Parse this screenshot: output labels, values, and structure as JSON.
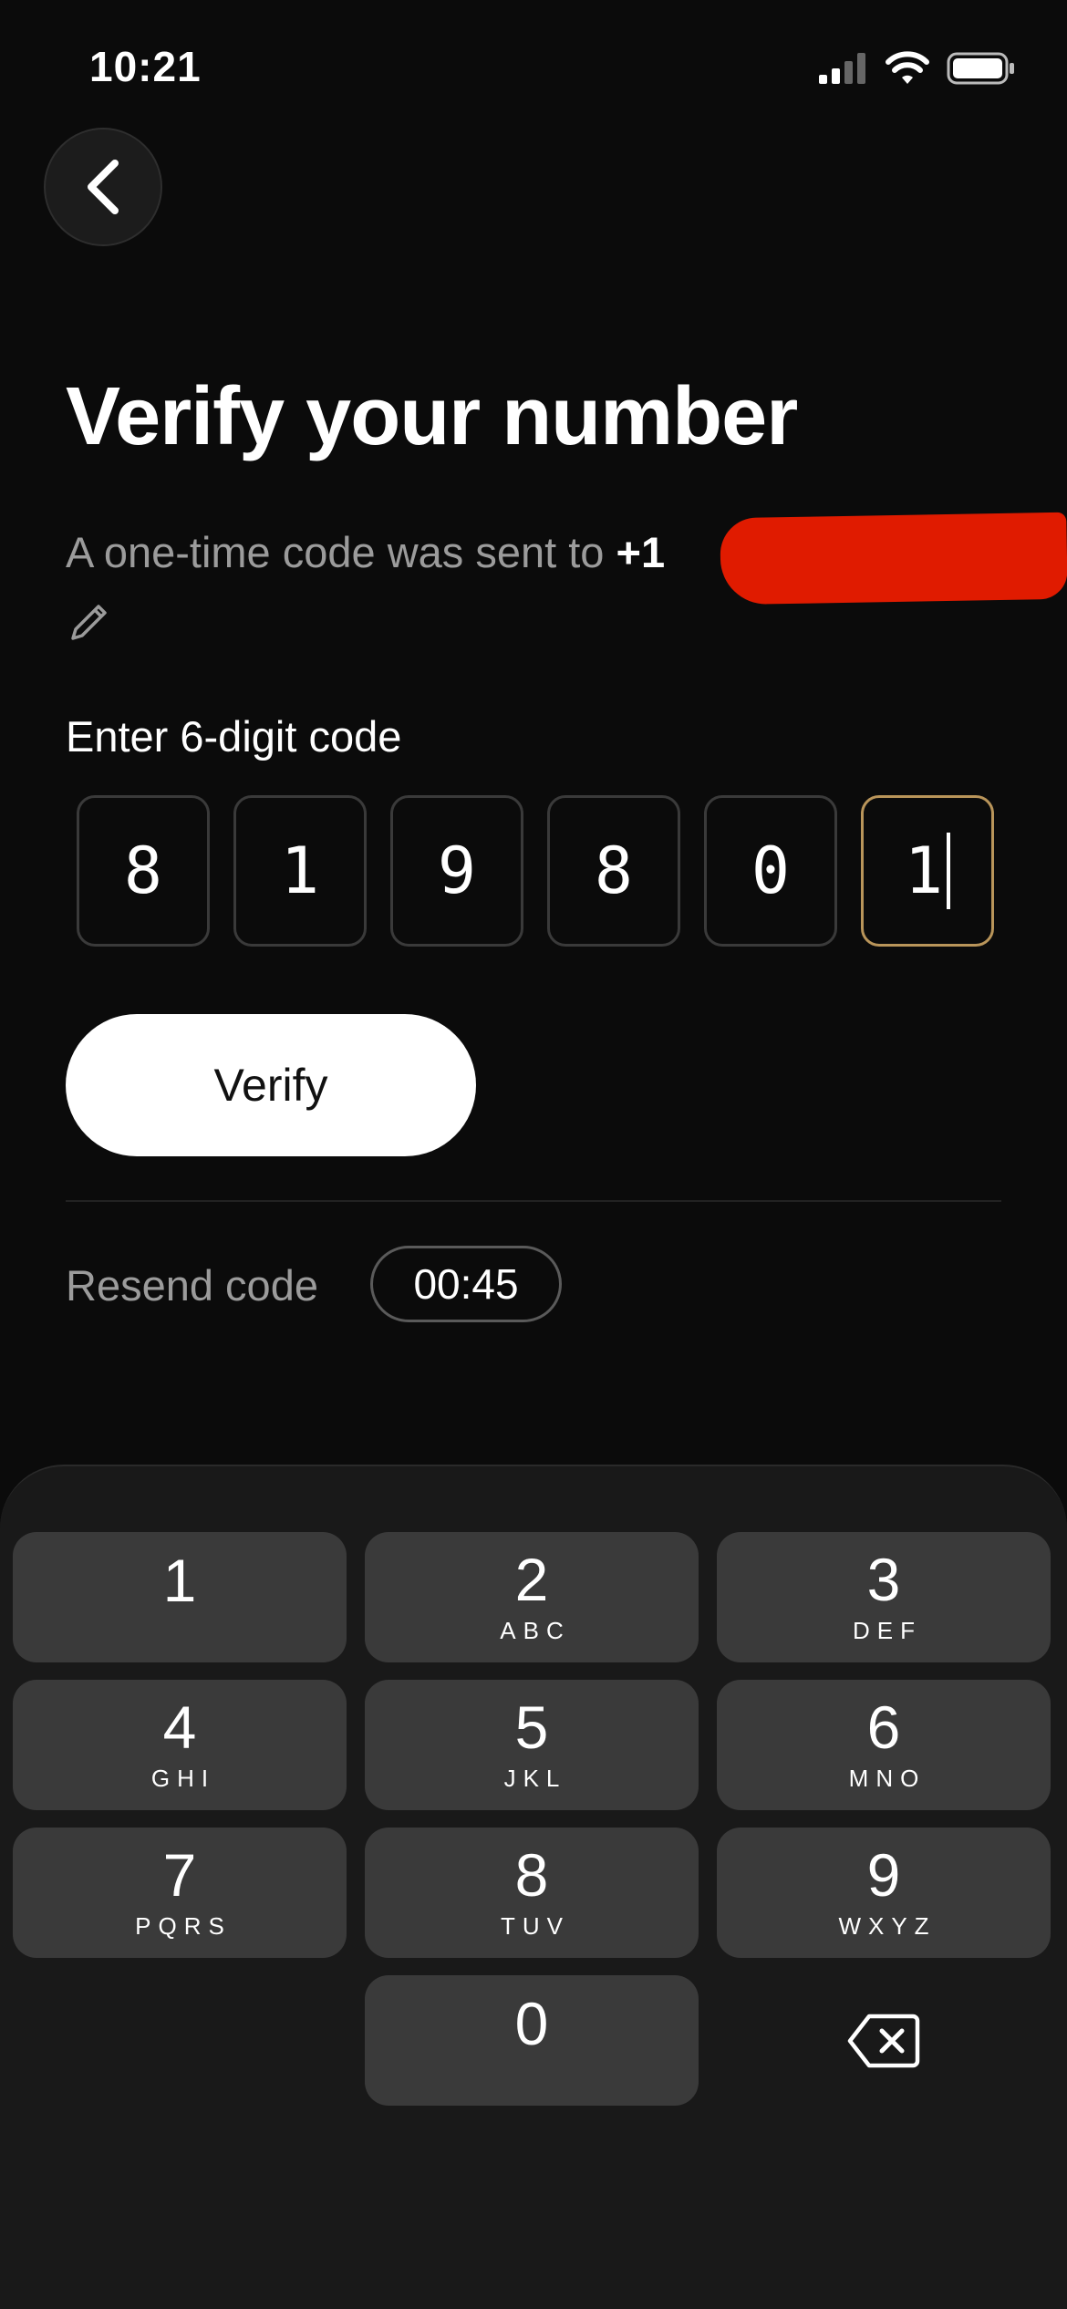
{
  "status": {
    "time": "10:21"
  },
  "title": "Verify your number",
  "subtitle": {
    "text": "A one-time code was sent to ",
    "phone_prefix": "+1"
  },
  "code_label": "Enter 6-digit code",
  "code_digits": [
    "8",
    "1",
    "9",
    "8",
    "0",
    "1"
  ],
  "verify_label": "Verify",
  "resend": {
    "label": "Resend code",
    "timer": "00:45"
  },
  "keypad": {
    "keys": [
      {
        "digit": "1",
        "letters": ""
      },
      {
        "digit": "2",
        "letters": "ABC"
      },
      {
        "digit": "3",
        "letters": "DEF"
      },
      {
        "digit": "4",
        "letters": "GHI"
      },
      {
        "digit": "5",
        "letters": "JKL"
      },
      {
        "digit": "6",
        "letters": "MNO"
      },
      {
        "digit": "7",
        "letters": "PQRS"
      },
      {
        "digit": "8",
        "letters": "TUV"
      },
      {
        "digit": "9",
        "letters": "WXYZ"
      },
      {
        "digit": "0",
        "letters": ""
      }
    ]
  },
  "colors": {
    "background": "#0b0b0b",
    "accent_border": "#b9955a",
    "keypad_key": "#3a3a3a"
  },
  "icons": [
    "back-chevron-icon",
    "edit-pencil-icon",
    "backspace-icon",
    "signal-icon",
    "wifi-icon",
    "battery-icon"
  ]
}
